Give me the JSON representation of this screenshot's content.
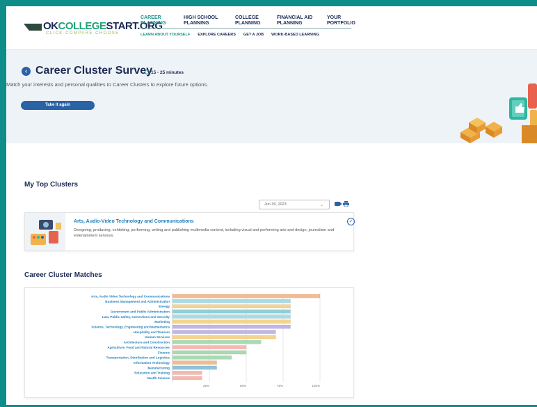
{
  "header": {
    "logo": {
      "ok": "OK",
      "college": "COLLEGE",
      "start": "START.ORG",
      "tagline": "CLICK·COMPARE·CHOOSE"
    },
    "nav_main": [
      {
        "label": "CAREER\nPLANNING",
        "active": true
      },
      {
        "label": "HIGH SCHOOL\nPLANNING",
        "active": false
      },
      {
        "label": "COLLEGE\nPLANNING",
        "active": false
      },
      {
        "label": "FINANCIAL AID\nPLANNING",
        "active": false
      },
      {
        "label": "YOUR\nPORTFOLIO",
        "active": false
      }
    ],
    "nav_sub": [
      {
        "label": "LEARN ABOUT YOURSELF",
        "active": true
      },
      {
        "label": "EXPLORE CAREERS",
        "active": false
      },
      {
        "label": "GET A JOB",
        "active": false
      },
      {
        "label": "WORK-BASED LEARNING",
        "active": false
      }
    ]
  },
  "hero": {
    "back_icon": "chevron-left-icon",
    "title": "Career Cluster Survey",
    "time": "15 - 25 minutes",
    "description": "Match your interests and personal qualities to Career Clusters to explore future options.",
    "retake_label": "Take it again"
  },
  "top_clusters": {
    "title": "My Top Clusters",
    "date": "Jun 30, 2023",
    "card": {
      "name": "Arts, Audio-Video Technology and Communications",
      "description": "Designing, producing, exhibiting, performing, writing and publishing multimedia content, including visual and performing arts and design, journalism and entertainment services."
    }
  },
  "matches": {
    "title": "Career Cluster Matches"
  },
  "chart_data": {
    "type": "bar",
    "orientation": "horizontal",
    "categories": [
      "Arts, Audio Video Technology and Communications",
      "Business Management and Administration",
      "Energy",
      "Government and Public Administration",
      "Law, Public Safety, Corrections and Security",
      "Marketing",
      "Science, Technology, Engineering and Mathematics",
      "Hospitality and Tourism",
      "Human Services",
      "Architecture and Construction",
      "Agriculture, Food and Natural Resources",
      "Finance",
      "Transportation, Distribution and Logistics",
      "Information Technology",
      "Manufacturing",
      "Education and Training",
      "Health Science"
    ],
    "values": [
      100,
      80,
      80,
      80,
      80,
      80,
      80,
      70,
      70,
      60,
      50,
      50,
      40,
      30,
      30,
      20,
      20
    ],
    "colors": [
      "#f5b98e",
      "#a8dbe3",
      "#f5d48f",
      "#8fd0d8",
      "#a8dbe3",
      "#f5d48f",
      "#c2b6e8",
      "#c2b6e8",
      "#f5d48f",
      "#a9dbb3",
      "#f5b9b0",
      "#a9dbb3",
      "#a9dbb3",
      "#f5b98e",
      "#8fc3dc",
      "#f5b9b0",
      "#f5b9b0"
    ],
    "ticks": [
      "25%",
      "50%",
      "75%",
      "100%"
    ],
    "xlim": [
      0,
      100
    ]
  }
}
